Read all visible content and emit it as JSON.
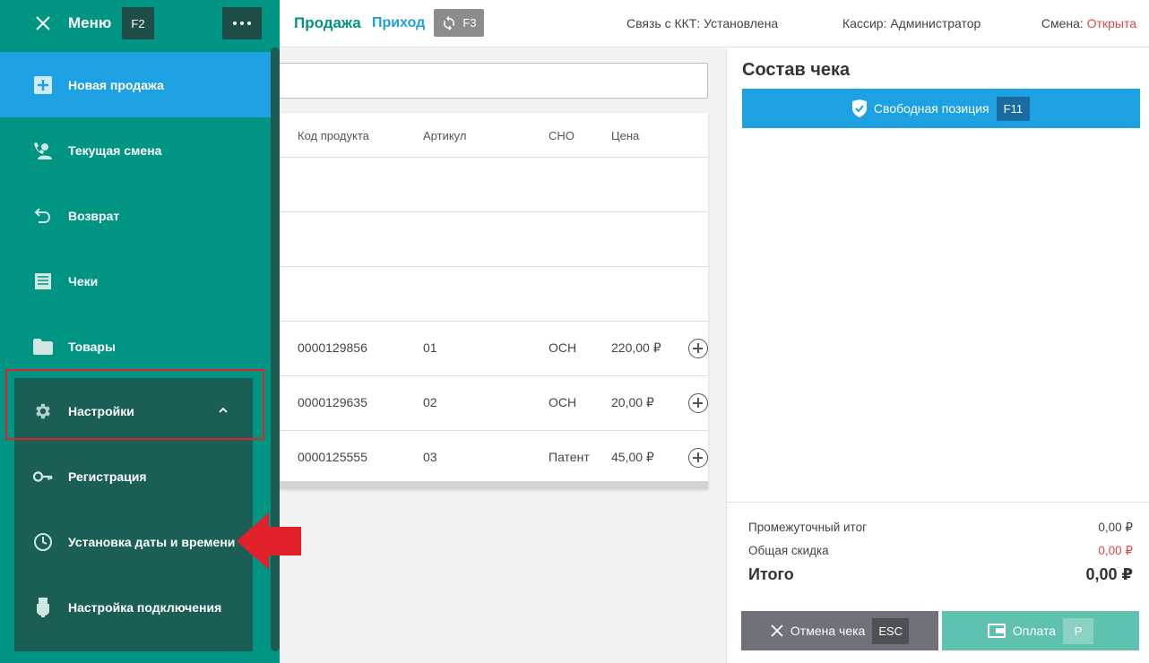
{
  "sidebar": {
    "title": "Меню",
    "menu_key": "F2",
    "items": [
      {
        "label": "Новая продажа",
        "icon": "plus-box-icon"
      },
      {
        "label": "Текущая смена",
        "icon": "person-phone-icon"
      },
      {
        "label": "Возврат",
        "icon": "undo-icon"
      },
      {
        "label": "Чеки",
        "icon": "receipt-icon"
      },
      {
        "label": "Товары",
        "icon": "folder-icon"
      },
      {
        "label": "Настройки",
        "icon": "gear-icon"
      }
    ],
    "submenu": [
      {
        "label": "Регистрация",
        "icon": "key-icon"
      },
      {
        "label": "Установка даты и времени",
        "icon": "clock-icon"
      },
      {
        "label": "Настройка подключения",
        "icon": "usb-icon"
      }
    ]
  },
  "header": {
    "tab_sale": "Продажа",
    "tab_income": "Приход",
    "sync_key": "F3",
    "kkt_status": "Связь с ККТ: Установлена",
    "cashier": "Кассир: Администратор",
    "shift_label": "Смена:",
    "shift_value": "Открыта"
  },
  "table": {
    "columns": [
      "Код продукта",
      "Артикул",
      "СНО",
      "Цена"
    ],
    "rows": [
      {
        "code": "0000129856",
        "article": "01",
        "sno": "ОСН",
        "price": "220,00 ₽"
      },
      {
        "code": "0000129635",
        "article": "02",
        "sno": "ОСН",
        "price": "20,00 ₽"
      },
      {
        "code": "0000125555",
        "article": "03",
        "sno": "Патент",
        "price": "45,00 ₽"
      }
    ]
  },
  "receipt": {
    "title": "Состав чека",
    "free_position_label": "Свободная позиция",
    "free_position_key": "F11",
    "subtotal_label": "Промежуточный итог",
    "subtotal_value": "0,00 ₽",
    "discount_label": "Общая скидка",
    "discount_value": "0,00 ₽",
    "total_label": "Итого",
    "total_value": "0,00 ₽",
    "cancel_label": "Отмена чека",
    "cancel_key": "ESC",
    "pay_label": "Оплата",
    "pay_key": "P"
  },
  "colors": {
    "sidebar": "#009582",
    "submenu": "#1b5e56",
    "accent_blue": "#1da1e2",
    "highlight_red": "#e0202a"
  }
}
